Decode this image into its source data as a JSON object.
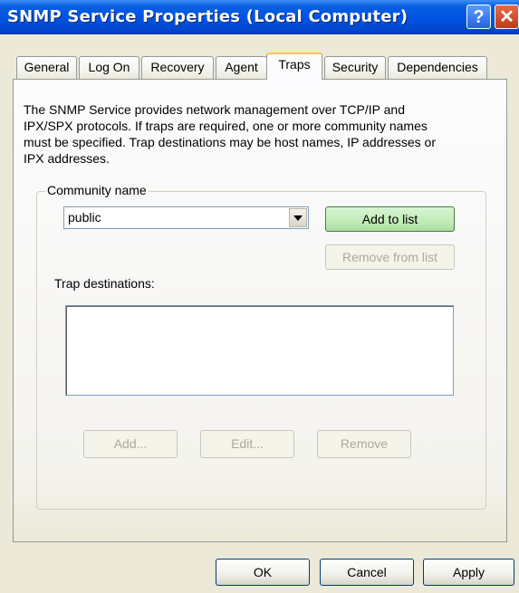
{
  "window": {
    "title": "SNMP Service Properties (Local Computer)",
    "help_glyph": "?",
    "close_glyph": "✕"
  },
  "tabs": [
    {
      "label": "General"
    },
    {
      "label": "Log On"
    },
    {
      "label": "Recovery"
    },
    {
      "label": "Agent"
    },
    {
      "label": "Traps",
      "active": true
    },
    {
      "label": "Security"
    },
    {
      "label": "Dependencies"
    }
  ],
  "traps": {
    "description": "The SNMP Service provides network management over TCP/IP and IPX/SPX protocols. If traps are required, one or more community names must be specified. Trap destinations may be host names, IP addresses or IPX addresses.",
    "community_group_label": "Community name",
    "community_value": "public",
    "add_to_list_label": "Add to list",
    "remove_from_list_label": "Remove from list",
    "trap_destinations_label": "Trap destinations:",
    "trap_destinations": [],
    "add_label": "Add...",
    "edit_label": "Edit...",
    "remove_label": "Remove"
  },
  "footer": {
    "ok_label": "OK",
    "cancel_label": "Cancel",
    "apply_label": "Apply"
  }
}
